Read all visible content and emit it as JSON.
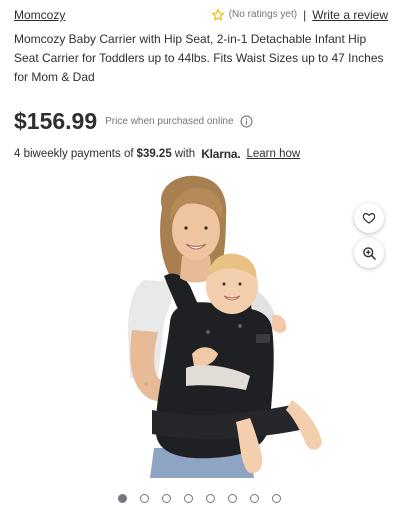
{
  "header": {
    "brand": "Momcozy",
    "ratings_text": "(No ratings yet)",
    "separator": "|",
    "write_review": "Write a review",
    "star_icon": "star-outline-icon",
    "star_color": "#f2b807"
  },
  "product": {
    "title": "Momcozy Baby Carrier with Hip Seat, 2-in-1 Detachable Infant Hip Seat Carrier for Toddlers up to 44lbs. Fits Waist Sizes up to 47 Inches for Mom & Dad",
    "price": "$156.99",
    "price_note": "Price when purchased online",
    "info_icon": "info-circle-icon"
  },
  "klarna": {
    "prefix": "4 biweekly payments of",
    "amount": "$39.25",
    "with": "with",
    "logo": "Klarna.",
    "learn_how": "Learn how"
  },
  "gallery": {
    "image_alt": "Woman wearing baby carrier with hip seat holding smiling baby",
    "favorite_icon": "heart-icon",
    "zoom_icon": "zoom-in-icon",
    "dot_count": 8,
    "active_index": 0
  },
  "colors": {
    "text": "#2e2f32",
    "muted": "#74767c",
    "carrier": "#1f2024"
  }
}
